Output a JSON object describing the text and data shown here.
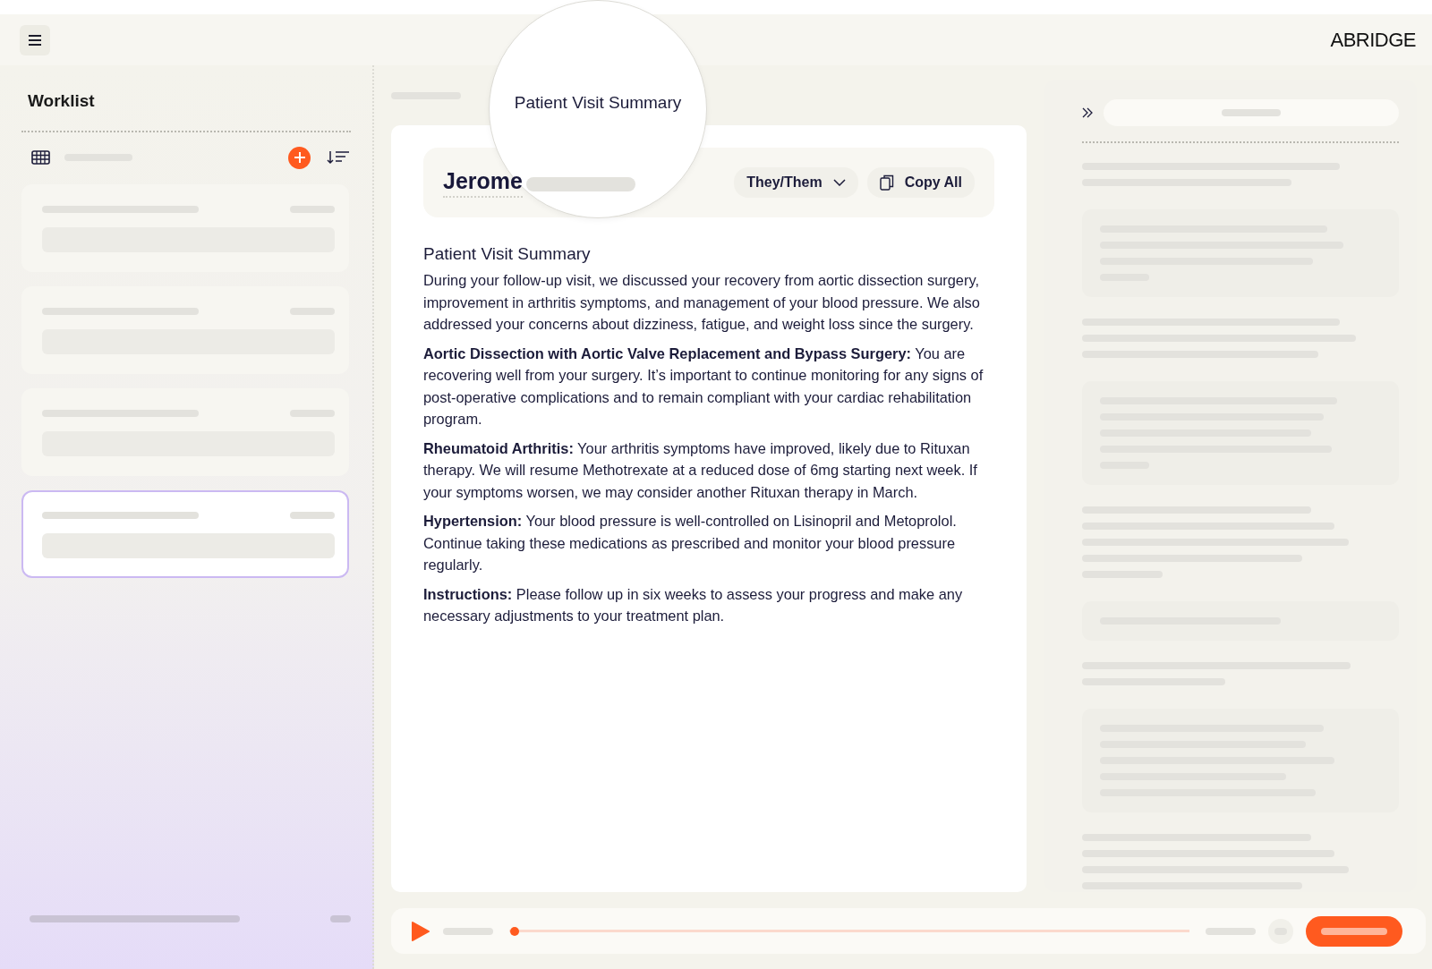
{
  "header": {
    "logo": "ABRIDGE"
  },
  "sidebar": {
    "title": "Worklist",
    "items": [
      {
        "selected": false
      },
      {
        "selected": false
      },
      {
        "selected": false
      },
      {
        "selected": true
      }
    ]
  },
  "magnifier": {
    "label": "Patient Visit Summary"
  },
  "patient": {
    "name": "Jerome",
    "pronouns": "They/Them",
    "copy_button": "Copy All"
  },
  "summary": {
    "title": "Patient Visit Summary",
    "paragraphs": [
      "During your follow-up visit, we discussed your recovery from aortic dissection surgery, improvement in arthritis symptoms, and management of your blood pressure. We also addressed your concerns about dizziness, fatigue, and weight loss since the surgery.",
      "**Aortic Dissection with Aortic Valve Replacement and Bypass Surgery:** You are recovering well from your surgery. It’s important to continue monitoring for any signs of post-operative complications and to remain compliant with your cardiac rehabilitation program.",
      "**Rheumatoid Arthritis:** Your arthritis symptoms have improved, likely due to Rituxan therapy. We will resume Methotrexate at a reduced dose of 6mg starting next week. If your symptoms worsen, we may consider another Rituxan therapy in March.",
      "**Hypertension:** Your blood pressure is well-controlled on Lisinopril and Metoprolol. Continue taking these medications as prescribed and monitor your blood pressure regularly.",
      "**Instructions:** Please follow up in six weeks to assess your progress and make any necessary adjustments to your treatment plan."
    ]
  },
  "player": {
    "level": 0
  }
}
